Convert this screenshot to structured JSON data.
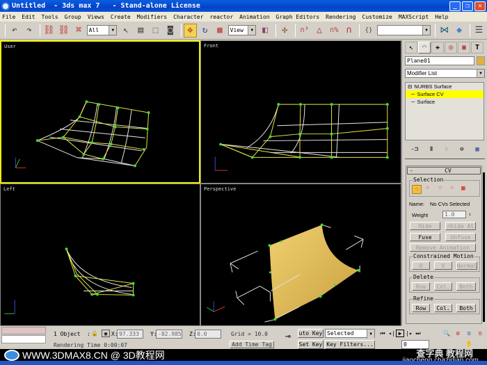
{
  "window": {
    "title": "Untitled  - 3ds max 7   - Stand-alone License",
    "minimize": "_",
    "restore": "❐",
    "close": "✕"
  },
  "menu": [
    "File",
    "Edit",
    "Tools",
    "Group",
    "Views",
    "Create",
    "Modifiers",
    "Character",
    "reactor",
    "Animation",
    "Graph Editors",
    "Rendering",
    "Customize",
    "MAXScript",
    "Help"
  ],
  "toolbar": {
    "selection_filter": "All",
    "ref_coord": "View",
    "named_selection": "",
    "icons": {
      "undo": "↶",
      "redo": "↷",
      "link": "⛓",
      "unlink": "⛓",
      "bind": "⌘",
      "select": "↖",
      "select_name": "▤",
      "rect_region": "⬚",
      "window_crossing": "◙",
      "move": "✥",
      "rotate": "↻",
      "scale": "■",
      "pivot": "◧",
      "manipulate": "✣",
      "snap3": "∩³",
      "angle_snap": "△",
      "percent_snap": "∩%",
      "spinner_snap": "∩",
      "edit_named": "{}",
      "mirror": "⋈",
      "align": "◆",
      "layers": "☰"
    }
  },
  "viewports": [
    {
      "name": "User",
      "active": true
    },
    {
      "name": "Front",
      "active": false
    },
    {
      "name": "Left",
      "active": false
    },
    {
      "name": "Perspective",
      "active": false
    }
  ],
  "colors": {
    "cv": "#3cdc3c",
    "lattice": "#e8e840",
    "wire": "#e8e8e8",
    "surface": "#e8c860",
    "active_border": "#f0f000",
    "highlight": "#ffff00"
  },
  "command_panel": {
    "tabs": [
      "create",
      "modify",
      "hierarchy",
      "motion",
      "display",
      "utilities"
    ],
    "tab_icons": [
      "↖",
      "◠",
      "⚹",
      "◎",
      "▣",
      "T"
    ],
    "object_name": "Plane01",
    "modifier_list": "Modifier List",
    "stack": [
      {
        "label": "NURBS Surface",
        "prefix": "⊟",
        "highlighted": false
      },
      {
        "label": "Surface CV",
        "prefix": "─",
        "highlighted": true
      },
      {
        "label": "Surface",
        "prefix": "─",
        "highlighted": false
      }
    ],
    "stack_tools": [
      "-⊐",
      "Ⅱ",
      "∨",
      "⊖",
      "▦"
    ],
    "rollout": {
      "title": "CV",
      "collapse": "-",
      "selection_group": "Selection",
      "selection_icons": [
        "⁘",
        "⁘",
        "⁘",
        "⁘",
        "▦"
      ],
      "name_label": "Name:",
      "name_value": "No CVs Selected",
      "weight_label": "Weight",
      "weight_value": "1.0",
      "hide": "Hide",
      "unhide_all": "nhide Al",
      "fuse": "Fuse",
      "unfuse": "Unfuse",
      "remove_animation": "Remove Animation",
      "constrained_group": "Constrained Motion",
      "u": "U",
      "v": "V",
      "normal": "Normal",
      "delete_group": "Delete",
      "delete_row": "Row",
      "delete_col": "Col.",
      "delete_both": "Both",
      "refine_group": "Refine",
      "refine_row": "Row",
      "refine_col": "Col.",
      "refine_both": "Both"
    }
  },
  "status": {
    "selection": "1 Object",
    "x_label": "X:",
    "x": "97.333",
    "y_label": "Y:",
    "y": "-82.985",
    "z_label": "Z:",
    "z": "0.0",
    "grid": "Grid = 10.0",
    "add_time_tag": "Add Time Tag",
    "rendering_time": "Rendering Time  0:00:07",
    "auto_key": "uto Key",
    "set_key": "Set Key",
    "key_mode": "Selected",
    "key_filters": "Key Filters...",
    "frame": "0",
    "playback_icons": [
      "⏮",
      "◂|",
      "▶",
      "|▸",
      "⏭"
    ],
    "nav_icons": [
      "🔍",
      "⊞",
      "⊡",
      "⊟",
      "✋",
      "⊕"
    ]
  },
  "watermark": {
    "left": "WWW.3DMAX8.CN @ 3D教程网",
    "right_cn": "查字典 教程网",
    "right_url": "jiaocheng.chazidian.com"
  }
}
